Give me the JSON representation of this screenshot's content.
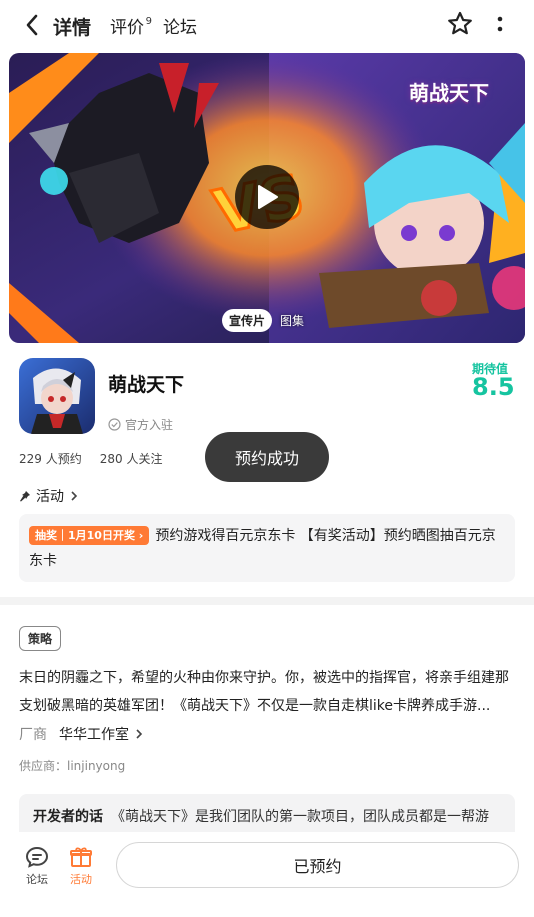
{
  "nav": {
    "tabs": [
      {
        "label": "详情",
        "active": true
      },
      {
        "label": "评价",
        "badge": "9"
      },
      {
        "label": "论坛"
      }
    ],
    "back_icon": "chevron-left-icon",
    "star_icon": "star-outline-icon",
    "more_icon": "more-vertical-icon"
  },
  "banner": {
    "game_title": "萌战天下",
    "tab_video": "宣传片",
    "tab_gallery": "图集"
  },
  "app": {
    "name": "萌战天下",
    "official": "官方入驻",
    "expect_label": "期待值",
    "expect_score": "8.5",
    "reservations": "229 人预约",
    "followers": "280 人关注"
  },
  "toast": "预约成功",
  "activity": {
    "header": "活动",
    "tag": "抽奖｜1月10日开奖 ›",
    "text": "预约游戏得百元京东卡 【有奖活动】预约晒图抽百元京东卡"
  },
  "detail": {
    "tag": "策略",
    "description": "末日的阴霾之下，希望的火种由你来守护。你，被选中的指挥官，将亲手组建那支划破黑暗的英雄军团！《萌战天下》不仅是一款自走棋like卡牌养成手游...",
    "vendor_label": "厂商",
    "vendor_name": "华华工作室",
    "supplier": "供应商：linjinyong"
  },
  "developer": {
    "label": "开发者的话",
    "text": "《萌战天下》是我们团队的第一款项目，团队成员都是一帮游"
  },
  "bottom": {
    "forum_label": "论坛",
    "activity_label": "活动",
    "reserved_button": "已预约"
  },
  "colors": {
    "accent": "#16c4a0",
    "tab_underline": "#25d6b4",
    "lottery": "#ff7a35"
  }
}
